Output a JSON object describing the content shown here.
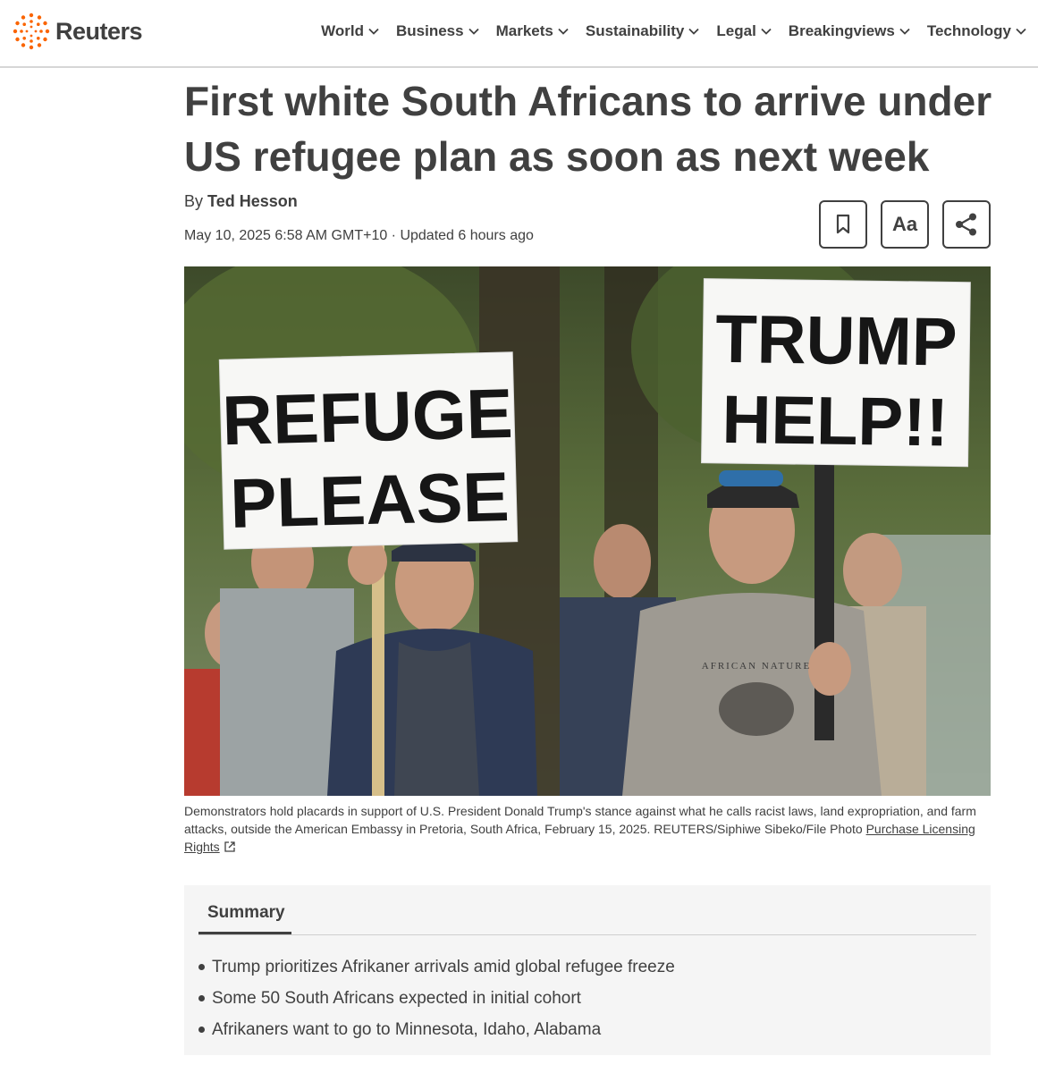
{
  "header": {
    "brand": "Reuters",
    "nav": [
      {
        "label": "World"
      },
      {
        "label": "Business"
      },
      {
        "label": "Markets"
      },
      {
        "label": "Sustainability"
      },
      {
        "label": "Legal"
      },
      {
        "label": "Breakingviews"
      },
      {
        "label": "Technology"
      }
    ]
  },
  "article": {
    "headline": "First white South Africans to arrive under US refugee plan as soon as next week",
    "byline_prefix": "By",
    "author": "Ted Hesson",
    "dateline": "May 10, 2025 6:58 AM GMT+10 · Updated 6 hours ago",
    "tools": {
      "bookmark_icon": "bookmark-icon",
      "text_size_label": "Aa",
      "share_icon": "share-icon"
    },
    "photo": {
      "sign_left_line1": "REFUGE",
      "sign_left_line2": "PLEASE",
      "sign_right_line1": "TRUMP",
      "sign_right_line2": "HELP!!",
      "shirt_text": "AFRICAN NATURE"
    },
    "caption": "Demonstrators hold placards in support of U.S. President Donald Trump's stance against what he calls racist laws, land expropriation, and farm attacks, outside the American Embassy in Pretoria, South Africa, February 15, 2025. REUTERS/Siphiwe Sibeko/File Photo ",
    "caption_link": "Purchase Licensing Rights"
  },
  "summary": {
    "tab_label": "Summary",
    "items": [
      "Trump prioritizes Afrikaner arrivals amid global refugee freeze",
      "Some 50 South Africans expected in initial cohort",
      "Afrikaners want to go to Minnesota, Idaho, Alabama"
    ]
  },
  "colors": {
    "text": "#404040",
    "brand_orange": "#fa6400",
    "summary_bg": "#f5f5f5"
  }
}
